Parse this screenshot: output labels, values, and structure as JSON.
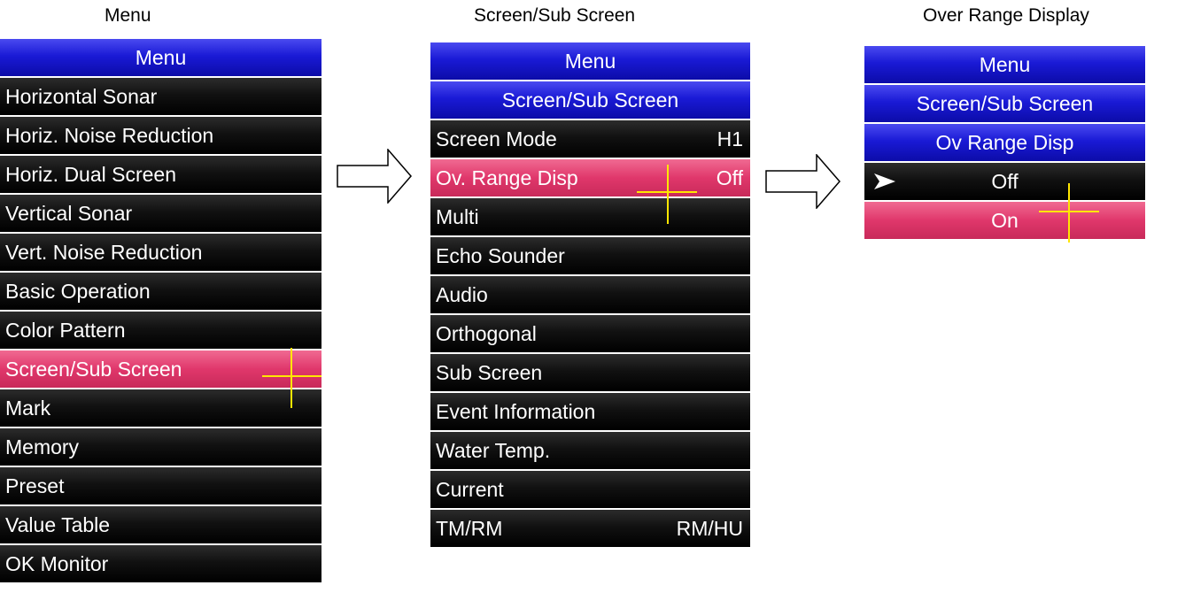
{
  "captions": {
    "left": "Menu",
    "middle": "Screen/Sub Screen",
    "right": "Over Range Display"
  },
  "menu": {
    "header": "Menu",
    "items": [
      {
        "label": "Horizontal Sonar"
      },
      {
        "label": "Horiz. Noise Reduction"
      },
      {
        "label": "Horiz. Dual Screen"
      },
      {
        "label": "Vertical Sonar"
      },
      {
        "label": "Vert. Noise Reduction"
      },
      {
        "label": "Basic Operation"
      },
      {
        "label": "Color Pattern"
      },
      {
        "label": "Screen/Sub Screen",
        "selected": true
      },
      {
        "label": "Mark"
      },
      {
        "label": "Memory"
      },
      {
        "label": "Preset"
      },
      {
        "label": "Value Table"
      },
      {
        "label": "OK Monitor"
      }
    ]
  },
  "screen_sub": {
    "header": "Menu",
    "subheader": "Screen/Sub Screen",
    "items": [
      {
        "label": "Screen Mode",
        "value": "H1"
      },
      {
        "label": "Ov. Range Disp",
        "value": "Off",
        "selected": true
      },
      {
        "label": "Multi",
        "value": ""
      },
      {
        "label": "Echo Sounder",
        "value": ""
      },
      {
        "label": "Audio",
        "value": ""
      },
      {
        "label": "Orthogonal",
        "value": ""
      },
      {
        "label": "Sub Screen",
        "value": ""
      },
      {
        "label": "Event Information",
        "value": ""
      },
      {
        "label": "Water Temp.",
        "value": ""
      },
      {
        "label": "Current",
        "value": ""
      },
      {
        "label": "TM/RM",
        "value": "RM/HU"
      }
    ]
  },
  "over_range": {
    "header": "Menu",
    "subheader": "Screen/Sub Screen",
    "subheader2": "Ov Range Disp",
    "options": [
      {
        "label": "Off",
        "current": true
      },
      {
        "label": "On",
        "selected": true
      }
    ]
  },
  "colors": {
    "header_blue": "#1a1ad6",
    "selected_pink": "#e0376b",
    "cursor_yellow": "#ffe600",
    "row_black": "#111111"
  }
}
